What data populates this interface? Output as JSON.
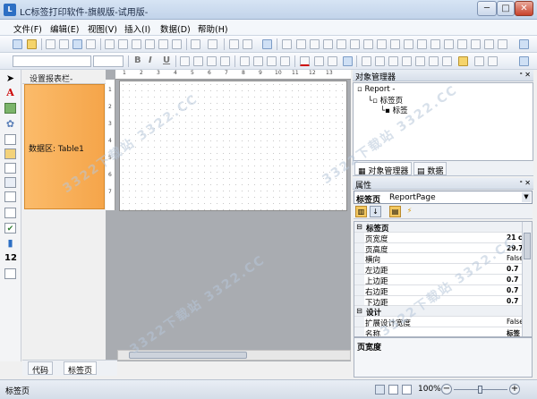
{
  "window": {
    "title": "LC标签打印软件-旗舰版-试用版-",
    "minimize": "─",
    "maximize": "□",
    "close": "✕"
  },
  "menubar": [
    "文件(F)",
    "编辑(E)",
    "视图(V)",
    "插入(I)",
    "数据(D)",
    "帮助(H)"
  ],
  "toolbar": {
    "bold": "B",
    "italic": "I",
    "underline": "U"
  },
  "band_panel": {
    "title": "设置报表栏-",
    "band_label": "数据区: Table1"
  },
  "ruler": {
    "h": [
      "1",
      "2",
      "3",
      "4",
      "5",
      "6",
      "7",
      "8",
      "9",
      "10",
      "11",
      "12",
      "13"
    ],
    "v": [
      "1",
      "2",
      "3",
      "4",
      "5",
      "6",
      "7"
    ]
  },
  "bottom_tabs": {
    "code": "代码",
    "label_page": "标签页"
  },
  "object_manager": {
    "title": "对象管理器",
    "pin": "ᐤ ✕",
    "tree": {
      "root": "Report -",
      "child": "标签页",
      "grandchild": "标签"
    },
    "tabs": {
      "objects": "对象管理器",
      "data": "数据"
    }
  },
  "properties": {
    "title": "属性",
    "pin": "ᐤ ✕",
    "selected_name": "标签页",
    "selected_type": "ReportPage",
    "rows": [
      {
        "name": "标签页",
        "value": "",
        "category": true
      },
      {
        "name": "页宽度",
        "value": "21 c",
        "category": false
      },
      {
        "name": "页高度",
        "value": "29.7",
        "category": false
      },
      {
        "name": "横向",
        "value": "False",
        "category": false
      },
      {
        "name": "左边距",
        "value": "0.7",
        "category": false
      },
      {
        "name": "上边距",
        "value": "0.7",
        "category": false
      },
      {
        "name": "右边距",
        "value": "0.7",
        "category": false
      },
      {
        "name": "下边距",
        "value": "0.7",
        "category": false
      },
      {
        "name": "设计",
        "value": "",
        "category": true
      },
      {
        "name": "扩展设计宽度",
        "value": "False",
        "category": false
      },
      {
        "name": "名称",
        "value": "标签",
        "category": false
      }
    ],
    "description_title": "页宽度"
  },
  "status": {
    "text": "标签页",
    "zoom": "100%"
  },
  "watermark": "3322下载站  3322.CC"
}
